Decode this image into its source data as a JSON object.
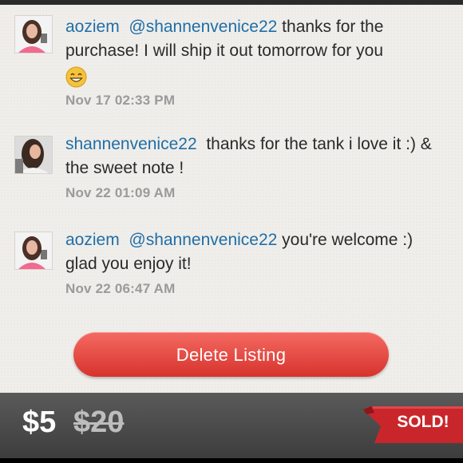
{
  "comments": [
    {
      "username": "aoziem",
      "mention": "@shannenvenice22",
      "text": " thanks for the purchase! I will ship it out tomorrow for you",
      "emoji": "smiling-face-icon",
      "time": "Nov 17 02:33 PM"
    },
    {
      "username": "shannenvenice22",
      "text": "thanks for the tank i love it :) & the sweet note !",
      "time": "Nov 22 01:09 AM"
    },
    {
      "username": "aoziem",
      "mention": "@shannenvenice22",
      "text": " you're welcome :) glad you enjoy it!",
      "time": "Nov 22 06:47 AM"
    }
  ],
  "actions": {
    "delete_label": "Delete Listing"
  },
  "listing": {
    "price": "$5",
    "original_price": "$20",
    "status": "SOLD!"
  },
  "colors": {
    "username": "#1f6ea8",
    "delete_button": "#e2463f",
    "sold_ribbon": "#c9262b"
  }
}
